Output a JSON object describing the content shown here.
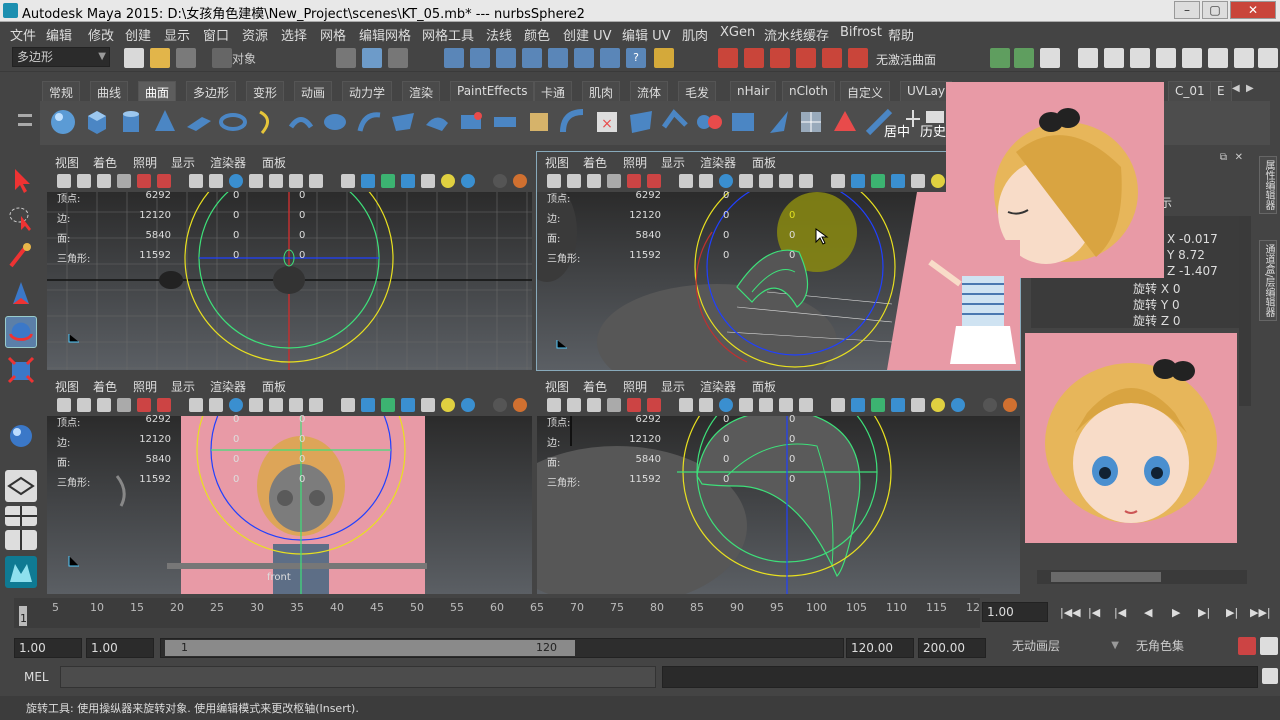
{
  "window": {
    "title": "Autodesk Maya 2015: D:\\女孩角色建模\\New_Project\\scenes\\KT_05.mb*   ---   nurbsSphere2"
  },
  "menu": [
    "文件",
    "编辑",
    "修改",
    "创建",
    "显示",
    "窗口",
    "资源",
    "选择",
    "网格",
    "编辑网格",
    "网格工具",
    "法线",
    "颜色",
    "创建 UV",
    "编辑 UV",
    "肌肉",
    "XGen",
    "流水线缓存",
    "Bifrost",
    "帮助"
  ],
  "status_line": {
    "mode": "多边形",
    "object_label": "对象",
    "no_live_surface": "无激活曲面"
  },
  "shelf_tabs": [
    "常规",
    "曲线",
    "曲面",
    "多边形",
    "变形",
    "动画",
    "动力学",
    "渲染",
    "PaintEffects",
    "卡通",
    "肌肉",
    "流体",
    "毛发",
    "nHair",
    "nCloth",
    "自定义",
    "UVLay",
    "C_01",
    "E"
  ],
  "shelf_active": "曲面",
  "shelf_labels": {
    "center_pivot": "居中",
    "history": "历史"
  },
  "viewport_menu": [
    "视图",
    "着色",
    "照明",
    "显示",
    "渲染器",
    "面板"
  ],
  "hud": {
    "labels": [
      "顶点:",
      "边:",
      "面:",
      "三角形:"
    ],
    "values": [
      "6292",
      "12120",
      "5840",
      "11592"
    ],
    "zeros": [
      "0",
      "0",
      "0",
      "0"
    ]
  },
  "cam_label": "front",
  "channel_box": {
    "header": "示",
    "translate": [
      "X -0.017",
      "Y 8.72",
      "Z -1.407"
    ],
    "rotate": [
      "旋转 X 0",
      "旋转 Y 0",
      "旋转 Z 0"
    ]
  },
  "side_tabs": [
    "属性编辑器",
    "通道盒/层编辑器"
  ],
  "timeline": {
    "ticks": [
      "5",
      "10",
      "15",
      "20",
      "25",
      "30",
      "35",
      "40",
      "45",
      "50",
      "55",
      "60",
      "65",
      "70",
      "75",
      "80",
      "85",
      "90",
      "95",
      "100",
      "105",
      "110",
      "115",
      "12"
    ],
    "current_frame": "1",
    "current_time_field": "1.00"
  },
  "range": {
    "start": "1.00",
    "playback_start": "1.00",
    "slider_start": "1",
    "slider_end": "120",
    "playback_end": "120.00",
    "end": "200.00",
    "anim_layer": "无动画层",
    "char_set": "无角色集"
  },
  "command": {
    "label": "MEL"
  },
  "help_text": "旋转工具: 使用操纵器来旋转对象. 使用编辑模式来更改枢轴(Insert).",
  "colors": {
    "accent": "#1c8fb0",
    "reference_bg": "#e89aa6",
    "wire_green": "#3ee07a",
    "ring_yellow": "#e8e020"
  }
}
